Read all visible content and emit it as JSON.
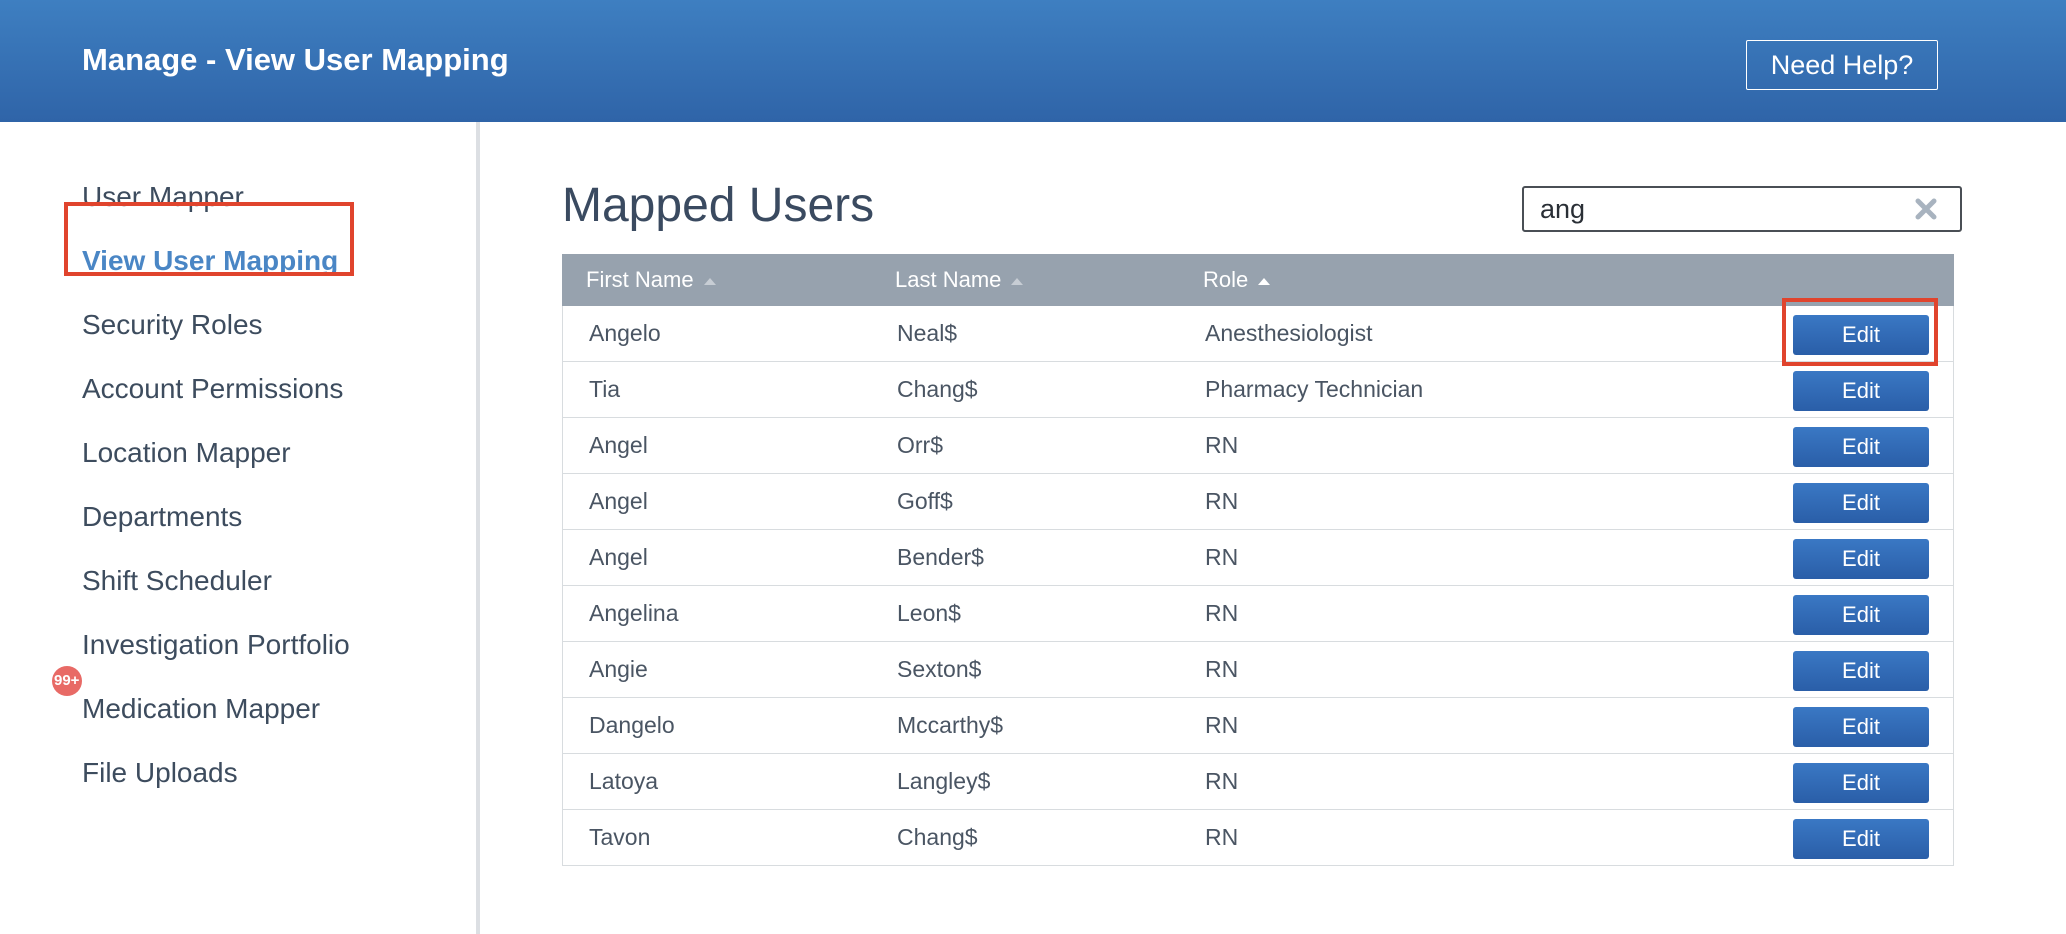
{
  "header": {
    "title": "Manage - View User Mapping",
    "help_label": "Need Help?"
  },
  "sidebar": {
    "items": [
      {
        "label": "User Mapper"
      },
      {
        "label": "View User Mapping",
        "active": true
      },
      {
        "label": "Security Roles"
      },
      {
        "label": "Account Permissions"
      },
      {
        "label": "Location Mapper"
      },
      {
        "label": "Departments"
      },
      {
        "label": "Shift Scheduler"
      },
      {
        "label": "Investigation Portfolio"
      },
      {
        "label": "Medication Mapper",
        "badge": "99+"
      },
      {
        "label": "File Uploads"
      }
    ]
  },
  "main": {
    "heading": "Mapped Users",
    "search": {
      "value": "ang",
      "clear_icon": "close-icon"
    },
    "table": {
      "columns": [
        "First Name",
        "Last Name",
        "Role"
      ],
      "sorted_column": "Role",
      "action_label": "Edit",
      "rows": [
        {
          "first": "Angelo",
          "last": "Neal$",
          "role": "Anesthesiologist"
        },
        {
          "first": "Tia",
          "last": "Chang$",
          "role": "Pharmacy Technician"
        },
        {
          "first": "Angel",
          "last": "Orr$",
          "role": "RN"
        },
        {
          "first": "Angel",
          "last": "Goff$",
          "role": "RN"
        },
        {
          "first": "Angel",
          "last": "Bender$",
          "role": "RN"
        },
        {
          "first": "Angelina",
          "last": "Leon$",
          "role": "RN"
        },
        {
          "first": "Angie",
          "last": "Sexton$",
          "role": "RN"
        },
        {
          "first": "Dangelo",
          "last": "Mccarthy$",
          "role": "RN"
        },
        {
          "first": "Latoya",
          "last": "Langley$",
          "role": "RN"
        },
        {
          "first": "Tavon",
          "last": "Chang$",
          "role": "RN"
        }
      ]
    }
  },
  "colors": {
    "header_gradient_top": "#3e7fc1",
    "header_gradient_bottom": "#2f64a8",
    "active_link": "#4a86c5",
    "highlight_outline": "#e0442d",
    "table_header": "#97a2ae",
    "edit_button": "#2f6ab6",
    "badge": "#e86a66"
  }
}
